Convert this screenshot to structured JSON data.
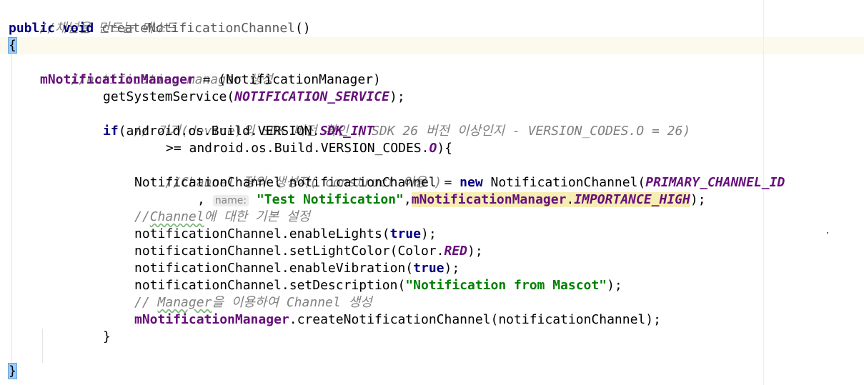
{
  "code": {
    "comment_method": "//채널을 만드는 메소드",
    "kw_public": "public",
    "kw_void": "void",
    "method_decl": "createNotificationChannel",
    "parens_open_close": "()",
    "open_brace": "{",
    "comment_manager": "//notification manager 생성",
    "field_manager": "mNotificationManager",
    "cast_text": " = (NotificationManager)",
    "call_getsystemservice": "getSystemService(",
    "const_notification_service": "NOTIFICATION_SERVICE",
    "close_paren_semicolon": ");",
    "comment_sdk_check": "// 기기(device)의 SDK 버전 확인 ( SDK 26 버전 이상인지 - VERSION_CODES.O = 26)",
    "kw_if": "if",
    "if_text": "(android.os.Build.VERSION.",
    "const_sdk_int": "SDK_INT",
    "gte_text": ">= android.os.Build.VERSION_CODES.",
    "const_o": "O",
    "paren_brace": "){",
    "comment_constructor": "//Channel 정의 생성자( construct 이용 )",
    "decl_text": "NotificationChannel notificationChannel = ",
    "kw_new": "new",
    "ctor_text": " NotificationChannel(",
    "const_primary_channel_id": "PRIMARY_CHANNEL_ID",
    "comma": ",",
    "param_hint_name": "name:",
    "str_test_notification": "\"Test Notification\"",
    "const_importance_high": "IMPORTANCE_HIGH",
    "comment_basic_prefix": "//",
    "comment_basic_channel": "Channel",
    "comment_basic_rest": "에 대한 기본 설정",
    "enable_lights_text": "notificationChannel.enableLights(",
    "kw_true": "true",
    "set_light_color_text": "notificationChannel.setLightColor(Color.",
    "const_red": "RED",
    "enable_vibration_text": "notificationChannel.enableVibration(",
    "set_description_text": "notificationChannel.setDescription(",
    "str_notification_from_mascot": "\"Notification from Mascot\"",
    "comment_create_prefix": "// ",
    "comment_create_manager": "Manager",
    "comment_create_rest": "을 이용하여 Channel 생성",
    "create_channel_text": ".createNotificationChannel(notificationChannel);",
    "inner_close_brace": "}",
    "outer_close_brace": "}",
    "dot": ".",
    "space": " "
  }
}
